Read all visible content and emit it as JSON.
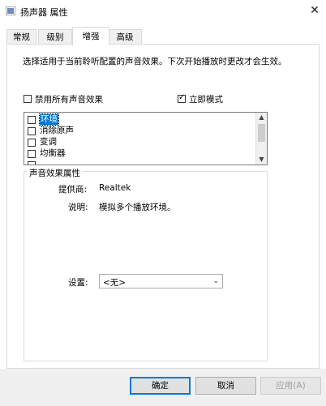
{
  "window": {
    "title": "扬声器 属性",
    "close_glyph": "✕",
    "app_icon": "speaker-icon"
  },
  "tabs": [
    {
      "label": "常规",
      "active": false
    },
    {
      "label": "级别",
      "active": false
    },
    {
      "label": "增强",
      "active": true
    },
    {
      "label": "高级",
      "active": false
    }
  ],
  "description": "选择适用于当前聆听配置的声音效果。下次开始播放时更改才会生效。",
  "disable_all": {
    "label": "禁用所有声音效果",
    "checked": false
  },
  "immediate_mode": {
    "label": "立即模式",
    "checked": true
  },
  "effects": [
    {
      "label": "环境",
      "checked": false,
      "selected": true
    },
    {
      "label": "消除原声",
      "checked": false,
      "selected": false
    },
    {
      "label": "变调",
      "checked": false,
      "selected": false
    },
    {
      "label": "均衡器",
      "checked": false,
      "selected": false
    }
  ],
  "properties": {
    "group_label": "声音效果属性",
    "provider_label": "提供商:",
    "provider_value": "Realtek",
    "description_label": "说明:",
    "description_value": "模拟多个播放环境。",
    "settings_label": "设置:",
    "settings_value": "<无>"
  },
  "buttons": {
    "ok": "确定",
    "cancel": "取消",
    "apply": "应用(A)"
  },
  "colors": {
    "selection": "#0078d7",
    "bottom_bar": "#f0f0f0"
  }
}
